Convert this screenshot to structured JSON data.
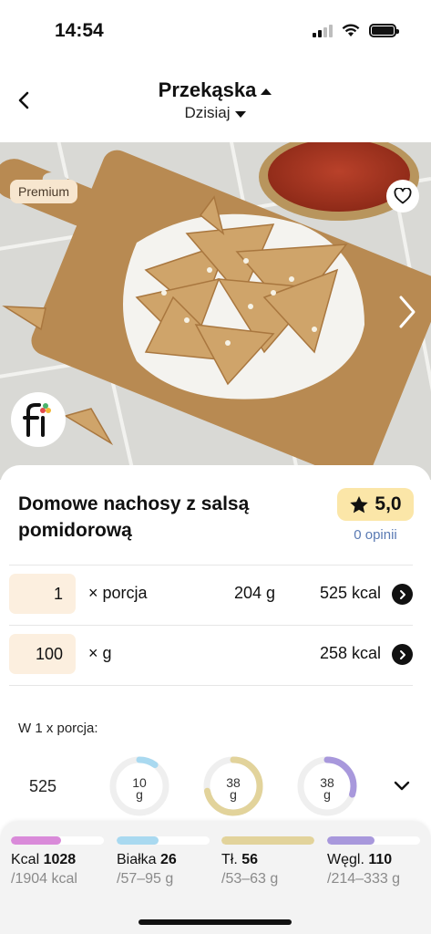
{
  "status": {
    "time": "14:54"
  },
  "header": {
    "title": "Przekąska",
    "subtitle": "Dzisiaj"
  },
  "hero": {
    "badge": "Premium"
  },
  "recipe": {
    "title": "Domowe nachosy z salsą pomidorową",
    "rating": "5,0",
    "reviews": "0 opinii"
  },
  "portions": [
    {
      "qty": "1",
      "unit": "× porcja",
      "grams": "204 g",
      "kcal": "525 kcal"
    },
    {
      "qty": "100",
      "unit": "× g",
      "grams": "",
      "kcal": "258 kcal"
    }
  ],
  "nutrition": {
    "per_label": "W 1 x porcja:",
    "kcal": "525",
    "macros": [
      {
        "value": "10",
        "unit": "g",
        "fraction": 0.1,
        "color": "#a9d9f0"
      },
      {
        "value": "38",
        "unit": "g",
        "fraction": 0.72,
        "color": "#e2d39b"
      },
      {
        "value": "38",
        "unit": "g",
        "fraction": 0.3,
        "color": "#a898dc"
      }
    ]
  },
  "summary": [
    {
      "label": "Kcal",
      "value": "1028",
      "range": "/1904 kcal",
      "fill": 0.54,
      "color": "#d98ad9"
    },
    {
      "label": "Białka",
      "value": "26",
      "range": "/57–95 g",
      "fill": 0.45,
      "color": "#a9d9f0"
    },
    {
      "label": "Tł.",
      "value": "56",
      "range": "/53–63 g",
      "fill": 1.0,
      "color": "#e2d39b"
    },
    {
      "label": "Węgl.",
      "value": "110",
      "range": "/214–333 g",
      "fill": 0.51,
      "color": "#a898dc"
    }
  ],
  "colors": {
    "accent": "#5a7ab3",
    "rating_bg": "#fbe6a8",
    "qty_bg": "#fcefdf"
  }
}
